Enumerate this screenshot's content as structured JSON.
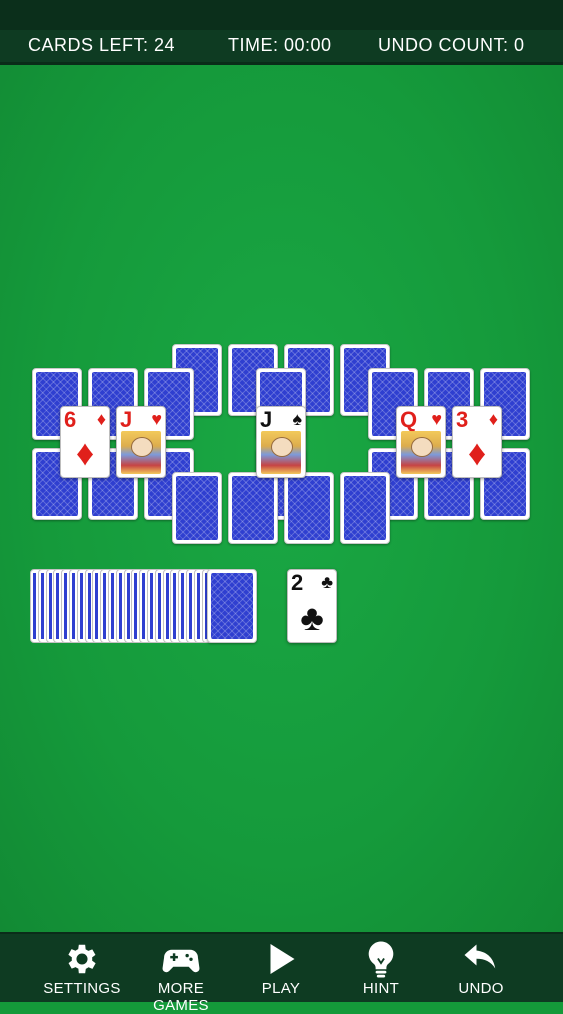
{
  "header": {
    "cards_left": "CARDS LEFT: 24",
    "time": "TIME: 00:00",
    "undo_count": "UNDO COUNT:  0"
  },
  "tableau": {
    "face_up": [
      {
        "rank": "6",
        "suit": "♦",
        "color": "red"
      },
      {
        "rank": "J",
        "suit": "♥",
        "color": "red"
      },
      {
        "rank": "J",
        "suit": "♠",
        "color": "black"
      },
      {
        "rank": "Q",
        "suit": "♥",
        "color": "red"
      },
      {
        "rank": "3",
        "suit": "♦",
        "color": "red"
      }
    ]
  },
  "waste": {
    "rank": "2",
    "suit": "♣",
    "color": "black"
  },
  "toolbar": {
    "settings": "SETTINGS",
    "more_games": "MORE GAMES",
    "play": "PLAY",
    "hint": "HINT",
    "undo": "UNDO"
  },
  "icons": {
    "settings": "gear-icon",
    "more_games": "gamepad-icon",
    "play": "play-icon",
    "hint": "lightbulb-icon",
    "undo": "undo-icon"
  },
  "colors": {
    "felt": "#149a3a",
    "bar": "#0e3b22",
    "card_back": "#2f3fd0",
    "red_suit": "#e0201b"
  }
}
